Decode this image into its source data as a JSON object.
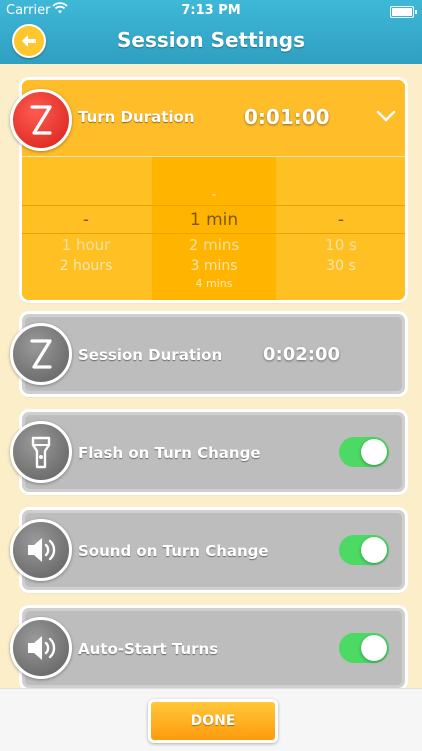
{
  "status_bar": {
    "carrier": "Carrier",
    "time": "7:13 PM"
  },
  "nav": {
    "title": "Session Settings"
  },
  "turn_duration": {
    "label": "Turn Duration",
    "value": "0:01:00",
    "picker": {
      "hours": {
        "selected": "-",
        "below": [
          "1 hour",
          "2 hours"
        ]
      },
      "minutes": {
        "above": [
          "-"
        ],
        "selected": "1 min",
        "below": [
          "2 mins",
          "3 mins",
          "4 mins"
        ]
      },
      "seconds": {
        "selected": "-",
        "below": [
          "10 s",
          "30 s"
        ]
      }
    }
  },
  "session_duration": {
    "label": "Session Duration",
    "value": "0:02:00"
  },
  "flash_on_turn_change": {
    "label": "Flash on Turn Change",
    "enabled": true
  },
  "sound_on_turn_change": {
    "label": "Sound on Turn Change",
    "enabled": true
  },
  "auto_start_turns": {
    "label": "Auto-Start Turns",
    "enabled": true
  },
  "done_button": {
    "label": "DONE"
  },
  "colors": {
    "nav_bar": "#3fb8d8",
    "accent": "#ffb300",
    "toggle_on": "#4cd964",
    "alert_circle": "#d6201a"
  }
}
